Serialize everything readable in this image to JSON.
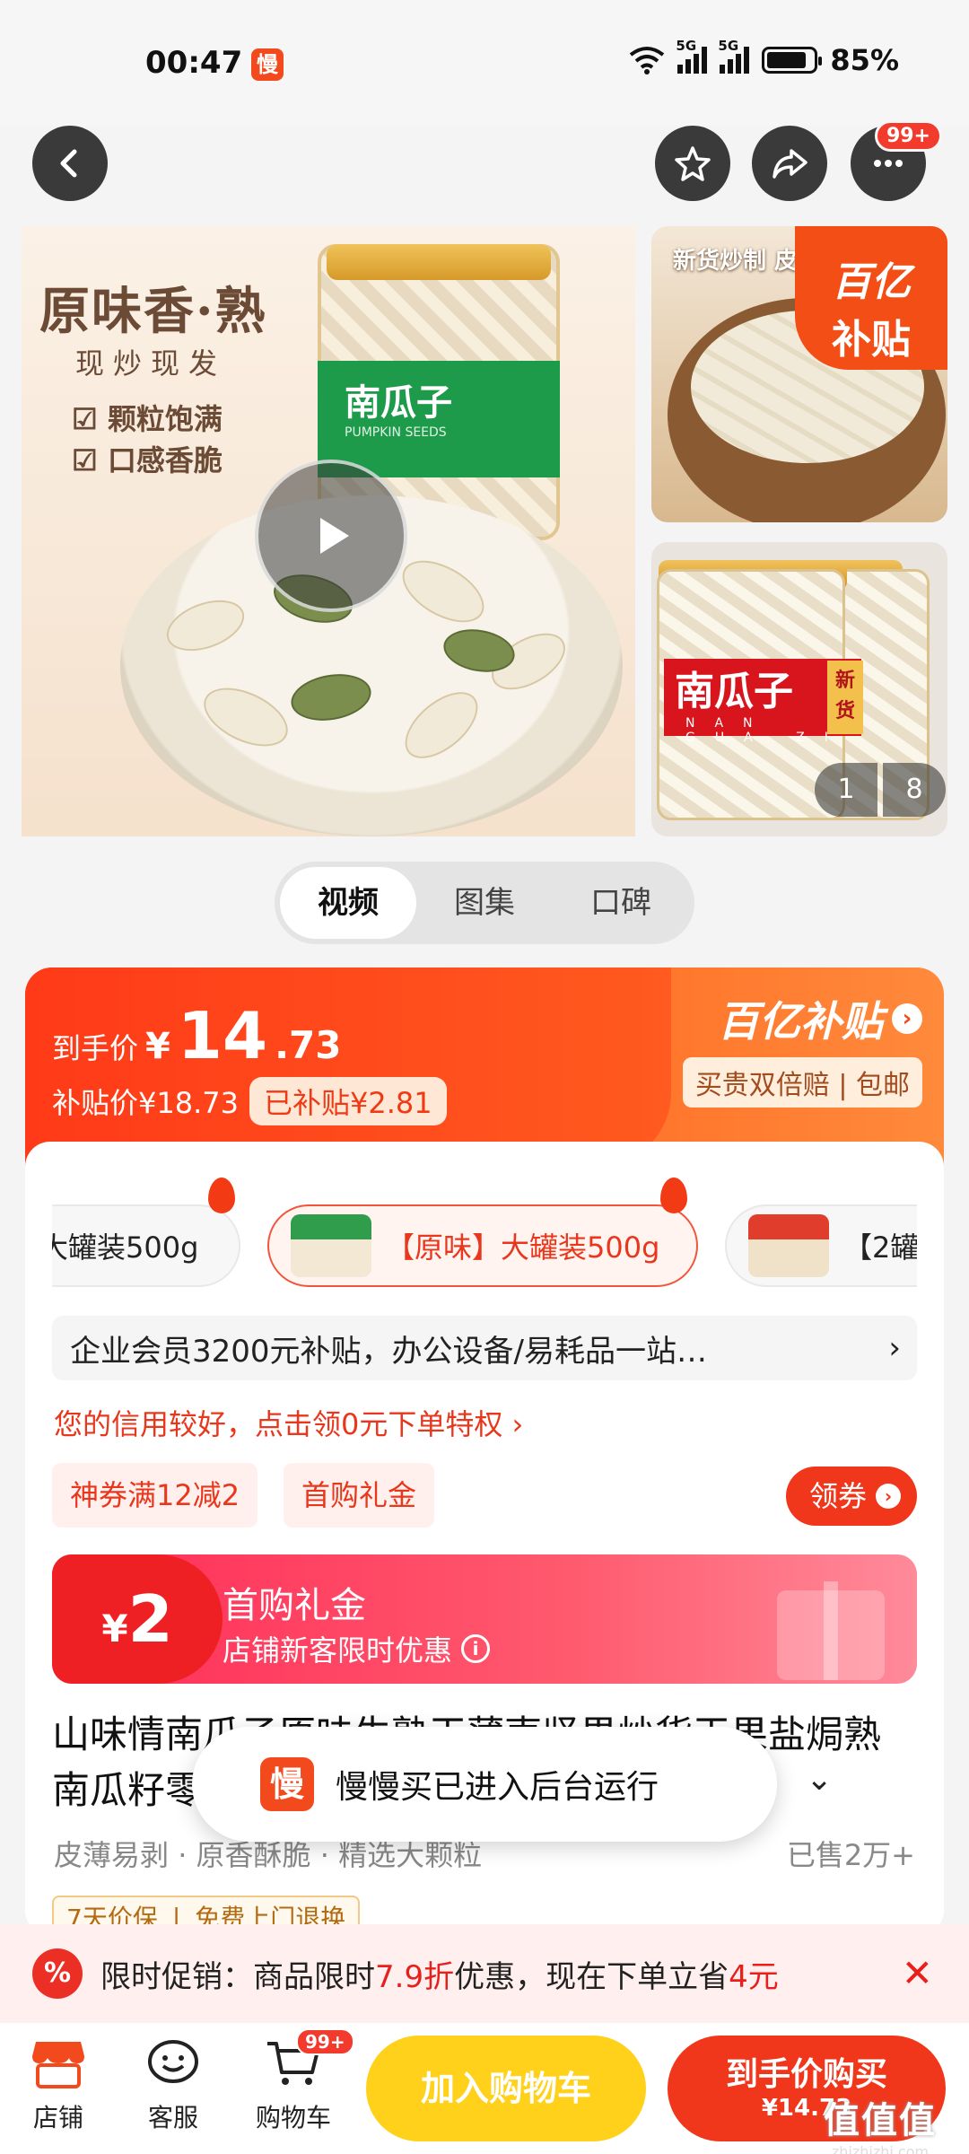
{
  "status_bar": {
    "time": "00:47",
    "app_badge": "慢",
    "net1": "5G",
    "net2": "5G",
    "battery": "85%",
    "battery_level": 0.85
  },
  "top_actions": {
    "more_badge": "99+"
  },
  "gallery": {
    "main": {
      "title": "原味香·熟",
      "subtitle": "现炒现发",
      "feature1": "颗粒饱满",
      "feature2": "口感香脆",
      "jar_label": "南瓜子",
      "jar_label_en": "PUMPKIN SEEDS"
    },
    "thumb1": {
      "text": "新货炒制 皮",
      "subsidy_a": "百亿",
      "subsidy_b": "补贴"
    },
    "thumb2": {
      "label": "南瓜子",
      "label_en": "NAN GUA ZI",
      "new": "新货"
    },
    "pager": [
      "1",
      "8"
    ]
  },
  "media_tabs": [
    "视频",
    "图集",
    "口碑"
  ],
  "price": {
    "label": "到手价",
    "currency": "¥",
    "integer": "14",
    "decimal": ".73",
    "sub_label": "补贴价¥18.73",
    "saved": "已补贴¥2.81",
    "brand": "百亿补贴",
    "guarantee": "买贵双倍赔 | 包邮"
  },
  "skus": [
    {
      "label": "大罐装500g"
    },
    {
      "label": "【原味】大罐装500g"
    },
    {
      "label": "【2罐"
    }
  ],
  "promo_line": {
    "text": "企业会员3200元补贴，办公设备/易耗品一站…",
    "arrow": "›"
  },
  "credit_line": "您的信用较好，点击领0元下单特权 ›",
  "coupons": {
    "chip1": "神券满12减2",
    "chip2": "首购礼金",
    "get": "领券"
  },
  "gift": {
    "currency": "¥",
    "amount": "2",
    "title": "首购礼金",
    "desc": "店铺新客限时优惠"
  },
  "product": {
    "title": "山味情南瓜子原味生熟干薄壳坚果炒货干果盐焗熟南瓜籽零食孕妇休闲零食解馋【原味】",
    "tags": [
      "皮薄易剥",
      "原香酥脆",
      "精选大颗粒"
    ],
    "sold": "已售2万+",
    "badge1": "7天价保",
    "badge2": "免费上门退换"
  },
  "toast": {
    "icon": "慢",
    "text": "慢慢买已进入后台运行"
  },
  "flash": {
    "label": "限时促销：商品限时",
    "discount": "7.9折",
    "mid": "优惠，现在下单立省",
    "save": "4元"
  },
  "bottom_nav": {
    "shop": "店铺",
    "service": "客服",
    "cart": "购物车",
    "cart_badge": "99+",
    "add_cart": "加入购物车",
    "buy_a": "到手价购买",
    "buy_b": "¥14.73"
  },
  "watermark": {
    "a": "值值值",
    "b": "zhizhizhi.com"
  },
  "colors": {
    "accent": "#f0361b",
    "cart_button": "#ffd11b",
    "brand_orange": "#f24a1d"
  }
}
